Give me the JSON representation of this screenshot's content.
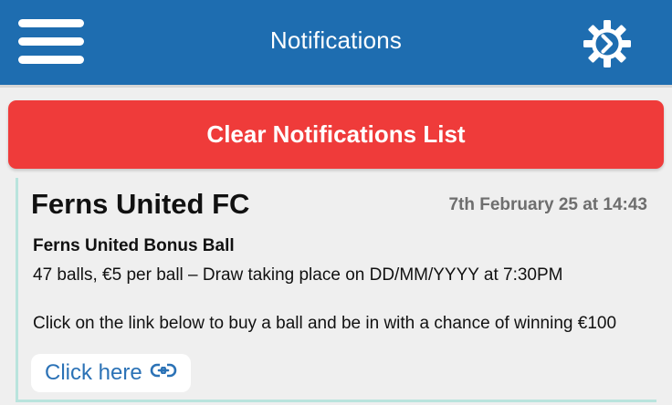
{
  "header": {
    "title": "Notifications",
    "menu_icon": "hamburger-menu-icon",
    "settings_icon": "gear-icon",
    "background_color": "#1e6db0"
  },
  "clear_button": {
    "label": "Clear Notifications List",
    "color": "#ef3b3a"
  },
  "notification": {
    "club": "Ferns United FC",
    "timestamp": "7th February 25 at 14:43",
    "title": "Ferns United Bonus Ball",
    "line1": "47 balls, €5 per ball – Draw taking place on DD/MM/YYYY at 7:30PM",
    "line2": "Click on the link below to buy a ball and be in with a chance of winning €100",
    "link_label": "Click here",
    "link_icon": "link-icon",
    "link_color": "#2b72b6",
    "accent_color": "#b9e4dd"
  }
}
